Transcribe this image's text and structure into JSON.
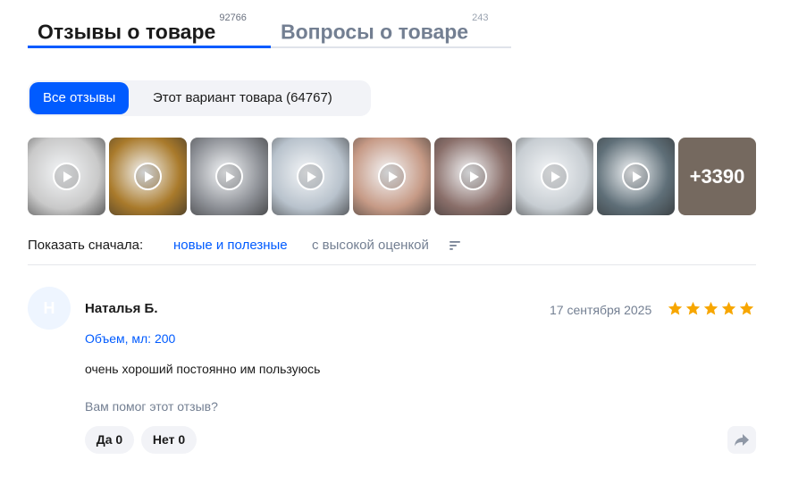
{
  "tabs": {
    "reviews": {
      "label": "Отзывы о товаре",
      "count": "92766"
    },
    "questions": {
      "label": "Вопросы о товаре",
      "count": "243"
    }
  },
  "filters": {
    "all_label": "Все отзывы",
    "variant_label": "Этот вариант товара (64767)"
  },
  "media": {
    "thumbnails": [
      {
        "type": "video",
        "bg": "#c9c9c9"
      },
      {
        "type": "video",
        "bg": "#a97a2b"
      },
      {
        "type": "video",
        "bg": "#8c8f95"
      },
      {
        "type": "video",
        "bg": "#b8c2cc"
      },
      {
        "type": "video",
        "bg": "#c69a86"
      },
      {
        "type": "video",
        "bg": "#8a6f6a"
      },
      {
        "type": "video",
        "bg": "#c7cdd2"
      },
      {
        "type": "video",
        "bg": "#5f6f78"
      }
    ],
    "more_label": "+3390",
    "more_bg": "#9d8d7f"
  },
  "sort": {
    "label": "Показать сначала:",
    "option_new": "новые и полезные",
    "option_high": "с высокой оценкой"
  },
  "review": {
    "avatar_initial": "Н",
    "author": "Наталья Б.",
    "date": "17 сентября 2025",
    "rating": 5,
    "variant": "Объем, мл: 200",
    "text": "очень хороший постоянно им пользуюсь",
    "helpful_question": "Вам помог этот отзыв?",
    "yes_label": "Да 0",
    "no_label": "Нет 0"
  },
  "colors": {
    "accent": "#005bff",
    "star": "#f7a600",
    "muted": "#737f92"
  }
}
